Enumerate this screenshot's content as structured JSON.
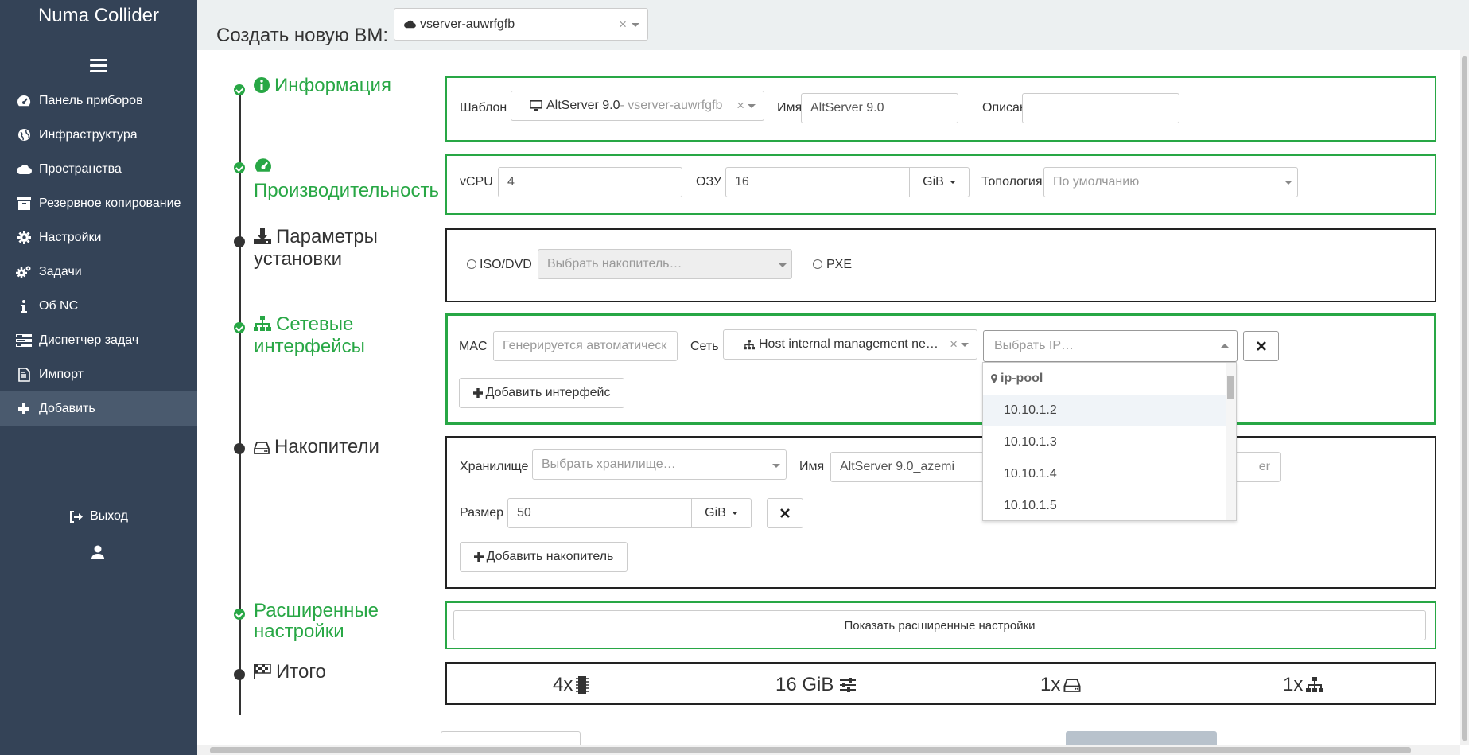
{
  "app": {
    "title": "Numa Collider"
  },
  "sidebar": {
    "items": [
      {
        "label": "Панель приборов",
        "icon": "dashboard-icon"
      },
      {
        "label": "Инфраструктура",
        "icon": "globe-icon"
      },
      {
        "label": "Пространства",
        "icon": "cloud-icon"
      },
      {
        "label": "Резервное копирование",
        "icon": "archive-icon"
      },
      {
        "label": "Настройки",
        "icon": "gear-icon"
      },
      {
        "label": "Задачи",
        "icon": "gears-icon"
      },
      {
        "label": "Об NC",
        "icon": "info-icon"
      },
      {
        "label": "Диспетчер задач",
        "icon": "tasks-icon"
      },
      {
        "label": "Импорт",
        "icon": "file-import-icon"
      },
      {
        "label": "Добавить",
        "icon": "plus-icon",
        "active": true
      }
    ],
    "logout": "Выход"
  },
  "header": {
    "title": "Создать новую ВМ:",
    "pool_select": "vserver-auwrfgfb"
  },
  "sections": {
    "info": {
      "title": "Информация",
      "template_label": "Шаблон",
      "template_value": "AltServer 9.0",
      "template_pool": " - vserver-auwrfgfb",
      "name_label": "Имя",
      "name_value": "AltServer 9.0",
      "desc_label": "Описание",
      "desc_value": ""
    },
    "perf": {
      "title": "Производительность",
      "vcpu_label": "vCPU",
      "vcpu_value": "4",
      "ram_label": "ОЗУ",
      "ram_value": "16",
      "ram_unit": "GiB",
      "topology_label": "Топология",
      "topology_placeholder": "По умолчанию"
    },
    "install": {
      "title": "Параметры установки",
      "iso_label": "ISO/DVD",
      "iso_placeholder": "Выбрать накопитель…",
      "pxe_label": "PXE"
    },
    "network": {
      "title": "Сетевые интерфейсы",
      "mac_label": "MAC",
      "mac_placeholder": "Генерируется автоматическ",
      "net_label": "Сеть",
      "net_value": "Host internal management ne…",
      "ip_placeholder": "Выбрать IP…",
      "add_button": "Добавить интерфейс"
    },
    "storage": {
      "title": "Накопители",
      "sr_label": "Хранилище",
      "sr_placeholder": "Выбрать хранилище…",
      "name_label": "Имя",
      "name_value": "AltServer 9.0_azemi",
      "desc_partial": "er",
      "size_label": "Размер",
      "size_value": "50",
      "size_unit": "GiB",
      "add_button": "Добавить накопитель"
    },
    "advanced": {
      "title": "Расширенные настройки",
      "button": "Показать расширенные настройки"
    },
    "summary": {
      "title": "Итого",
      "cpu": "4x",
      "ram": "16 GiB",
      "disks": "1x",
      "nets": "1x"
    }
  },
  "ip_dropdown": {
    "group": "ip-pool",
    "options": [
      "10.10.1.2",
      "10.10.1.3",
      "10.10.1.4",
      "10.10.1.5"
    ]
  },
  "colors": {
    "sidebar": "#344357",
    "accent": "#28a745",
    "header": "#ecf0f1"
  }
}
